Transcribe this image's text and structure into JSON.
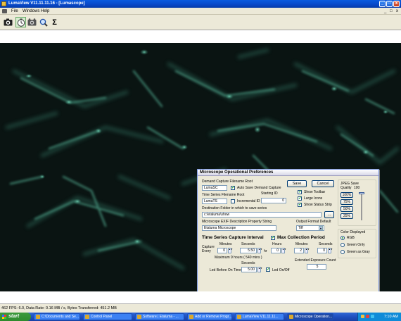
{
  "window": {
    "title": "LumaView  V11.11.11.16 - [Lumascope]",
    "minimize": "_",
    "maximize": "□",
    "close": "x"
  },
  "menu": {
    "items": [
      "File",
      "Windows",
      "Help"
    ],
    "mdi_controls": [
      "_",
      "□",
      "x"
    ]
  },
  "toolbar": {
    "icons": [
      "camera-icon",
      "timer-icon",
      "video-icon",
      "zoom-icon",
      "sigma-icon"
    ],
    "sigma_label": "Σ"
  },
  "status": {
    "text": "462  FPS: 6.0,  Data Rate: 0.16 MB / s,  Bytes Transferred: 451.2 MB"
  },
  "taskbar": {
    "start_label": "start",
    "tasks": [
      "C:\\Documents and Se...",
      "Control Panel",
      "Software | Etaluma - ...",
      "Add or Remove Progr...",
      "LumaView V11.11.11...",
      "Microscope Operation..."
    ],
    "clock": "7:10 AM"
  },
  "dialog": {
    "title": "Microscope Operational Preferences",
    "demand_root_label": "Demand Capture Filename Root",
    "demand_root_value": "LumaSC",
    "auto_save_label": "Auto Save Demand Capture",
    "timeseries_root_label": "Time Series Filename Root",
    "timeseries_root_value": "LumaTS",
    "starting_id_label": "Starting ID",
    "starting_id_value": "0",
    "incremental_id_label": "Incremental ID",
    "dest_label": "Destination Folder in which to save series",
    "dest_value": "c:\\etaluma\\show",
    "browse_label": "...",
    "exif_label": "Microscope EXIF Description Property String",
    "exif_value": "Etaluma Microscope",
    "output_format_label": "Output Format Default",
    "output_format_value": "Tiff",
    "save_label": "Save",
    "cancel_label": "Cancel",
    "show_toolbar_label": "Show Toolbar",
    "large_icons_label": "Large Icons",
    "show_status_label": "Show Status Strip",
    "jpeg_label": "JPEG Save Quality",
    "jpeg_value": "100",
    "zoom_buttons": [
      "100%",
      "75%",
      "50%",
      "25%"
    ],
    "color_group_label": "Color Displayed",
    "color_options": [
      "RGB",
      "Green Only",
      "Green as Gray"
    ],
    "tsc_label": "Time Series Capture Interval",
    "max_collection_label": "Max Collection Period",
    "capture_every_label": "Capture Every",
    "minutes_label": "Minutes",
    "seconds_label": "Seconds",
    "hours_label": "Hours",
    "interval_minutes": "0",
    "interval_seconds": "5.50",
    "hrs_unit": "hr",
    "max_hours": "0",
    "max_minutes": "2",
    "max_seconds": "0",
    "maximum_note": "Maximum 9 hours ( 540 mins )",
    "extended_label": "Extended Exposure Count",
    "extended_value": "5",
    "led_before_label": "Led Before On Time",
    "led_seconds_label": "Seconds",
    "led_before_value": "5.00",
    "led_onoff_label": "Led On/Off"
  }
}
